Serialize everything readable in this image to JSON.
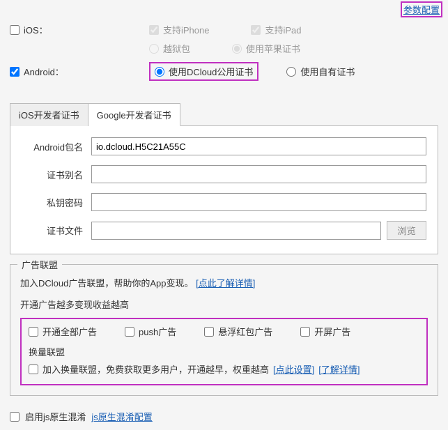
{
  "topLink": "参数配置",
  "ios": {
    "label": "iOS：",
    "supportIphone": "支持iPhone",
    "supportIpad": "支持iPad",
    "jailbreak": "越狱包",
    "appleCert": "使用苹果证书"
  },
  "android": {
    "label": "Android：",
    "dcloudCert": "使用DCloud公用证书",
    "ownCert": "使用自有证书"
  },
  "tabs": {
    "iosCert": "iOS开发者证书",
    "googleCert": "Google开发者证书"
  },
  "form": {
    "packageLabel": "Android包名",
    "packageValue": "io.dcloud.H5C21A55C",
    "aliasLabel": "证书别名",
    "aliasValue": "",
    "pkLabel": "私钥密码",
    "pkValue": "",
    "fileLabel": "证书文件",
    "fileValue": "",
    "browse": "浏览"
  },
  "ad": {
    "legend": "广告联盟",
    "joinText": "加入DCloud广告联盟，帮助你的App变现。",
    "joinLink": "[点此了解详情]",
    "moreText": "开通广告越多变现收益越高",
    "allAds": "开通全部广告",
    "pushAds": "push广告",
    "hongbaoAds": "悬浮红包广告",
    "splashAds": "开屏广告",
    "huanliangLabel": "换量联盟",
    "huanliangText": "加入换量联盟，免费获取更多用户，开通越早，权重越高",
    "huanliangSet": "[点此设置]",
    "huanliangMore": "[了解详情]"
  },
  "bottom": {
    "enableJs": "启用js原生混淆",
    "jsLink": "js原生混淆配置"
  }
}
